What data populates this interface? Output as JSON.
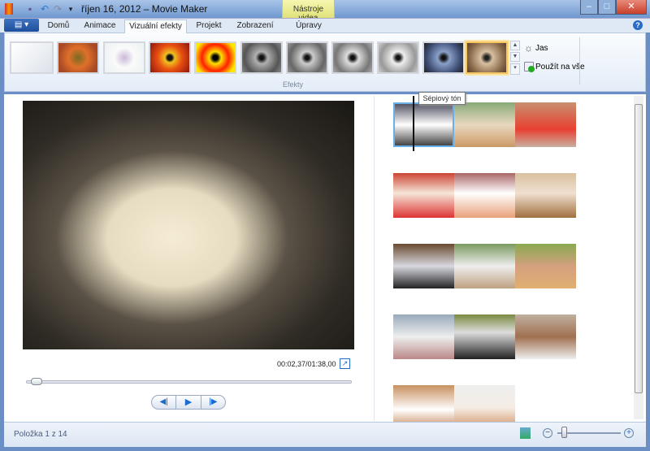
{
  "window": {
    "title": "říjen 16, 2012 – Movie Maker",
    "context_tab": "Nástroje videa"
  },
  "quick_access": [
    "save-icon",
    "undo-icon",
    "redo-icon",
    "customize-icon"
  ],
  "tabs": [
    {
      "label": "Domů"
    },
    {
      "label": "Animace"
    },
    {
      "label": "Vizuální efekty"
    },
    {
      "label": "Projekt"
    },
    {
      "label": "Zobrazení"
    },
    {
      "label": "Úpravy"
    }
  ],
  "ribbon": {
    "group_label": "Efekty",
    "jas": "Jas",
    "apply_all": "Použít na vše",
    "tooltip": "Sépiový tón",
    "effects": [
      {
        "name": "none",
        "bg": "linear-gradient(135deg,#fff,#dde2ea)"
      },
      {
        "name": "blur",
        "bg": "radial-gradient(circle,#7a6a20,#e0702a 40%,#a74a25 80%)"
      },
      {
        "name": "edge",
        "bg": "radial-gradient(circle,#c9b8d8,#fafafa 40%,#eef3f3 90%)"
      },
      {
        "name": "posterize",
        "bg": "radial-gradient(circle,#111 10%,#f0c020 20%,#e85010 50%,#a02010 90%)"
      },
      {
        "name": "threshold",
        "bg": "radial-gradient(circle,#000 10%,#ffe000 25%,#ff2000 55%,#ffe800 85%)"
      },
      {
        "name": "bw1",
        "bg": "radial-gradient(circle,#111 8%,#b0b0b0 25%,#555 70%,#888)"
      },
      {
        "name": "bw2",
        "bg": "radial-gradient(circle,#111 8%,#ccc 25%,#666 70%,#999)"
      },
      {
        "name": "bw3",
        "bg": "radial-gradient(circle,#111 8%,#ddd 25%,#777 70%,#aaa)"
      },
      {
        "name": "bw4",
        "bg": "radial-gradient(circle,#111 8%,#eee 25%,#999 70%,#ccc)"
      },
      {
        "name": "cyan",
        "bg": "radial-gradient(circle,#111 8%,#8aa0c8 25%,#3b4a70 70%,#222)"
      },
      {
        "name": "sepia",
        "bg": "radial-gradient(circle,#222 8%,#d8c0a0 25%,#8a6a4a 70%,#5a4030)",
        "selected": true
      }
    ]
  },
  "player": {
    "time": "00:02,37/01:38,00",
    "progress": 0.024
  },
  "storyboard": [
    [
      "linear-gradient(#556,#fff 50%,#444)",
      "linear-gradient(#8a7,#e8d8c0 50%,#c96)",
      "linear-gradient(#c89070,#e84030 60%,#c8b0a0)"
    ],
    [
      "linear-gradient(#c43,#f5e6d8 45%,#d33)",
      "linear-gradient(#a66,#fff 45%,#e8a07a)",
      "linear-gradient(#d8c0a0,#f0e0d0 45%,#a07040)"
    ],
    [
      "linear-gradient(#6a4a30,#d8d8e0 50%,#222)",
      "linear-gradient(#7a9a60,#eee 50%,#c0a080)",
      "linear-gradient(#8aaa50,#d4a080 50%,#e0b070)"
    ],
    [
      "linear-gradient(#9ab,#eee 50%,#b88)",
      "linear-gradient(#7a8a40,#ddd 40%,#222)",
      "linear-gradient(#c0b0a0,#a07050 50%,#eee)"
    ],
    [
      "linear-gradient(#c89060,#fff 55%,#c08050)",
      "linear-gradient(#eee,#f5ede5 50%,#d09060)"
    ]
  ],
  "status": {
    "text": "Položka 1 z 14",
    "zoom": 0.1
  }
}
